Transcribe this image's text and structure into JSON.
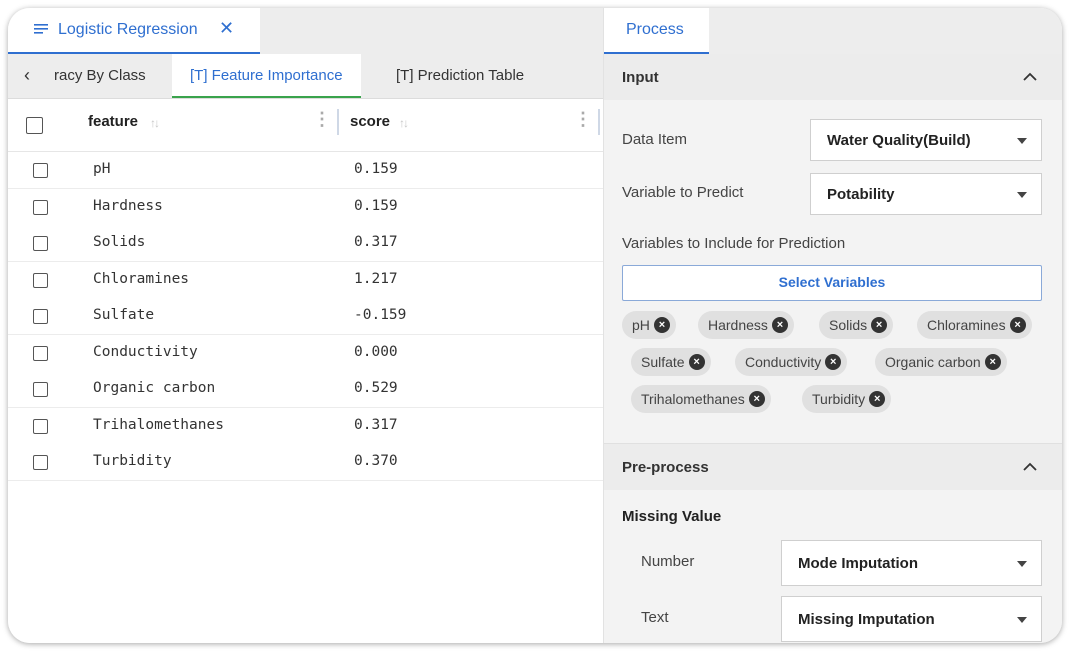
{
  "doc_tab": {
    "title": "Logistic Regression",
    "close_glyph": "✕"
  },
  "sub_tabs": [
    {
      "label": "racy By Class",
      "active": false
    },
    {
      "label": "[T] Feature Importance",
      "active": true
    },
    {
      "label": "[T] Prediction Table",
      "active": false
    }
  ],
  "sub_nav_prev": "‹",
  "grid": {
    "columns": [
      "feature",
      "score"
    ],
    "rows": [
      {
        "feature": "pH",
        "score": "0.159"
      },
      {
        "feature": "Hardness",
        "score": "0.159"
      },
      {
        "feature": "Solids",
        "score": "0.317"
      },
      {
        "feature": "Chloramines",
        "score": "1.217"
      },
      {
        "feature": "Sulfate",
        "score": "-0.159"
      },
      {
        "feature": "Conductivity",
        "score": "0.000"
      },
      {
        "feature": "Organic carbon",
        "score": "0.529"
      },
      {
        "feature": "Trihalomethanes",
        "score": "0.317"
      },
      {
        "feature": "Turbidity",
        "score": "0.370"
      }
    ]
  },
  "process": {
    "tab_label": "Process",
    "input": {
      "title": "Input",
      "data_item_label": "Data Item",
      "data_item_value": "Water Quality(Build)",
      "predict_label": "Variable to Predict",
      "predict_value": "Potability",
      "include_label": "Variables to Include for Prediction",
      "select_button": "Select Variables",
      "chips": [
        "pH",
        "Hardness",
        "Solids",
        "Chloramines",
        "Sulfate",
        "Conductivity",
        "Organic carbon",
        "Trihalomethanes",
        "Turbidity"
      ]
    },
    "preprocess": {
      "title": "Pre-process",
      "missing_value_heading": "Missing Value",
      "number_label": "Number",
      "number_value": "Mode Imputation",
      "text_label": "Text",
      "text_value": "Missing Imputation"
    }
  },
  "colors": {
    "accent": "#2f6fd0",
    "active_underline": "#3aa34c",
    "panel_bg": "#f3f3f3"
  }
}
